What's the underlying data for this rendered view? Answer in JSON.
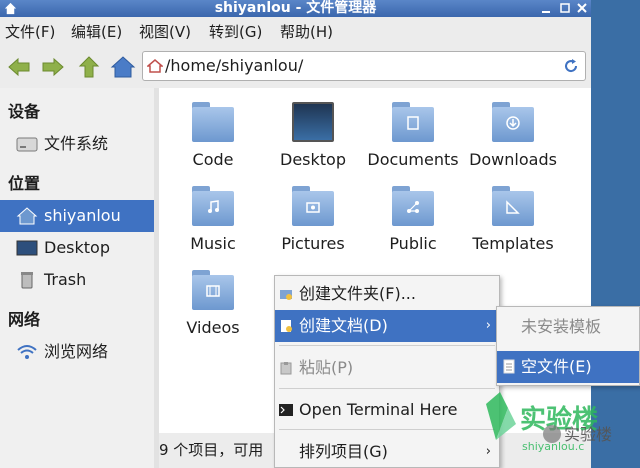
{
  "window": {
    "title": "shiyanlou - 文件管理器"
  },
  "menubar": {
    "items": [
      "文件(F)",
      "编辑(E)",
      "视图(V)",
      "转到(G)",
      "帮助(H)"
    ]
  },
  "toolbar": {
    "location": "/home/shiyanlou/"
  },
  "sidebar": {
    "devices_heading": "设备",
    "filesystem": "文件系统",
    "places_heading": "位置",
    "home": "shiyanlou",
    "desktop": "Desktop",
    "trash": "Trash",
    "network_heading": "网络",
    "browse_network": "浏览网络"
  },
  "files": [
    {
      "name": "Code"
    },
    {
      "name": "Desktop"
    },
    {
      "name": "Documents"
    },
    {
      "name": "Downloads"
    },
    {
      "name": "Music"
    },
    {
      "name": "Pictures"
    },
    {
      "name": "Public"
    },
    {
      "name": "Templates"
    },
    {
      "name": "Videos"
    }
  ],
  "statusbar": {
    "text": "9 个项目，可用"
  },
  "context_menu": {
    "create_folder": "创建文件夹(F)...",
    "create_document": "创建文档(D)",
    "paste": "粘贴(P)",
    "open_terminal": "Open Terminal Here",
    "arrange_items": "排列项目(G)"
  },
  "submenu": {
    "no_templates": "未安装模板",
    "empty_file": "空文件(E)"
  },
  "watermark": {
    "brand": "实验楼",
    "site": "shiyanlou.c",
    "wechat": "实验楼"
  },
  "colors": {
    "selection": "#3f72c2",
    "titlebar": "#3b67ad",
    "folder": "#6d98cf",
    "watermark_green": "#2eb85c"
  }
}
